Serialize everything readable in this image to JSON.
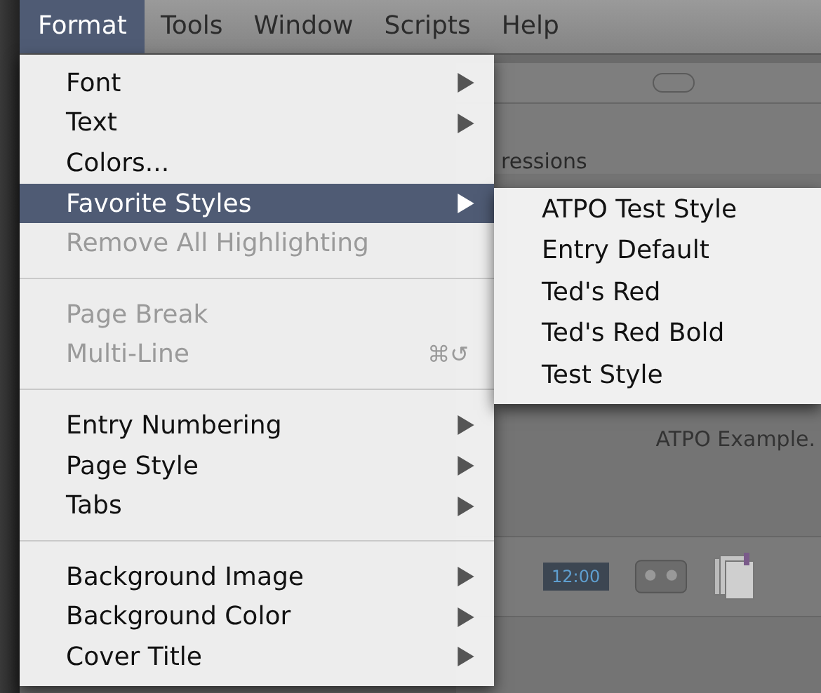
{
  "menu_bar": [
    {
      "label": "Format",
      "selected": true
    },
    {
      "label": "Tools",
      "selected": false
    },
    {
      "label": "Window",
      "selected": false
    },
    {
      "label": "Scripts",
      "selected": false
    },
    {
      "label": "Help",
      "selected": false
    }
  ],
  "menu": {
    "items": [
      {
        "kind": "item",
        "label": "Font",
        "submenu": true,
        "disabled": false,
        "selected": false
      },
      {
        "kind": "item",
        "label": "Text",
        "submenu": true,
        "disabled": false,
        "selected": false
      },
      {
        "kind": "item",
        "label": "Colors...",
        "submenu": false,
        "disabled": false,
        "selected": false
      },
      {
        "kind": "item",
        "label": "Favorite Styles",
        "submenu": true,
        "disabled": false,
        "selected": true
      },
      {
        "kind": "item",
        "label": "Remove All Highlighting",
        "submenu": false,
        "disabled": true,
        "selected": false
      },
      {
        "kind": "separator"
      },
      {
        "kind": "item",
        "label": "Page Break",
        "submenu": false,
        "disabled": true,
        "selected": false
      },
      {
        "kind": "item",
        "label": "Multi-Line",
        "submenu": false,
        "disabled": true,
        "selected": false,
        "shortcut": "⌘↺"
      },
      {
        "kind": "separator"
      },
      {
        "kind": "item",
        "label": "Entry Numbering",
        "submenu": true,
        "disabled": false,
        "selected": false
      },
      {
        "kind": "item",
        "label": "Page Style",
        "submenu": true,
        "disabled": false,
        "selected": false
      },
      {
        "kind": "item",
        "label": "Tabs",
        "submenu": true,
        "disabled": false,
        "selected": false
      },
      {
        "kind": "separator"
      },
      {
        "kind": "item",
        "label": "Background Image",
        "submenu": true,
        "disabled": false,
        "selected": false
      },
      {
        "kind": "item",
        "label": "Background Color",
        "submenu": true,
        "disabled": false,
        "selected": false
      },
      {
        "kind": "item",
        "label": "Cover Title",
        "submenu": true,
        "disabled": false,
        "selected": false
      }
    ]
  },
  "submenu": {
    "items": [
      "ATPO Test Style",
      "Entry Default",
      "Ted's Red",
      "Ted's Red Bold",
      "Test Style"
    ]
  },
  "background_window": {
    "text_fragment": "ressions",
    "document_name": "ATPO Example.",
    "clock_icon_time": "12:00"
  }
}
